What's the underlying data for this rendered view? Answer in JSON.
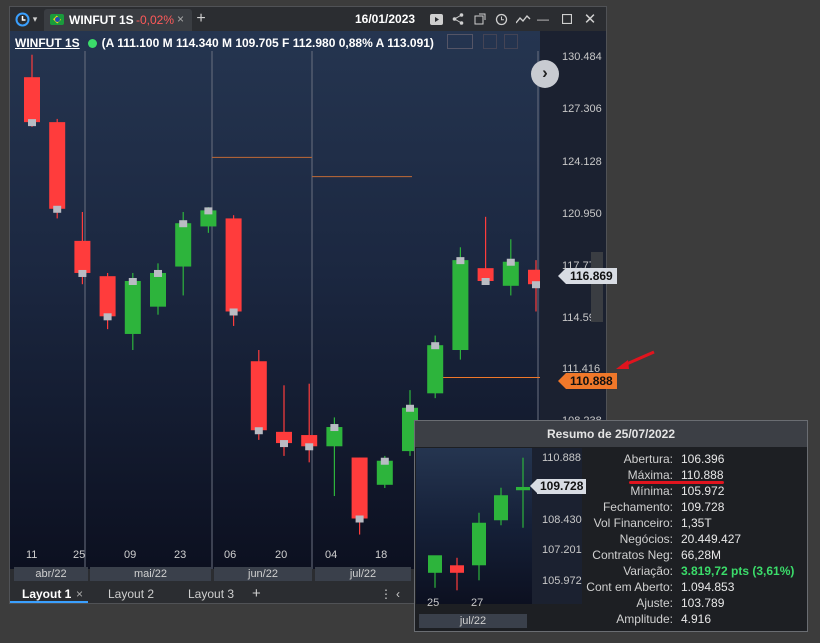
{
  "titlebar": {
    "tab_symbol": "WINFUT 1S",
    "tab_change": "-0,02%",
    "date": "16/01/2023"
  },
  "header": {
    "symbol": "WINFUT 1S",
    "quote": "(A 111.100 M 114.340 M 109.705 F 112.980 0,88% A 113.091)"
  },
  "price_scale": [
    "130.484",
    "127.306",
    "124.128",
    "120.950",
    "117.772",
    "114.594",
    "111.416",
    "108.238"
  ],
  "tags": {
    "last": "116.869",
    "high": "110.888"
  },
  "x_ticks": [
    "11",
    "25",
    "09",
    "23",
    "06",
    "20",
    "04",
    "18"
  ],
  "months": [
    "abr/22",
    "mai/22",
    "jun/22",
    "jul/22"
  ],
  "layouts": [
    "Layout 1",
    "Layout 2",
    "Layout 3"
  ],
  "colors": {
    "up": "#2db43c",
    "down": "#ff3c3c",
    "accent": "#f0782a"
  },
  "chart_data": {
    "type": "candlestick",
    "ylim": [
      105.5,
      131.5
    ],
    "candles": [
      {
        "o": 129.6,
        "h": 131.0,
        "l": 126.5,
        "c": 126.8
      },
      {
        "o": 126.8,
        "h": 127.0,
        "l": 120.8,
        "c": 121.4
      },
      {
        "o": 119.4,
        "h": 121.2,
        "l": 116.7,
        "c": 117.4
      },
      {
        "o": 117.2,
        "h": 117.4,
        "l": 113.9,
        "c": 114.7
      },
      {
        "o": 113.6,
        "h": 117.4,
        "l": 112.6,
        "c": 116.9
      },
      {
        "o": 115.3,
        "h": 118.0,
        "l": 114.8,
        "c": 117.4
      },
      {
        "o": 117.8,
        "h": 121.2,
        "l": 116.0,
        "c": 120.5
      },
      {
        "o": 120.3,
        "h": 121.5,
        "l": 119.9,
        "c": 121.3
      },
      {
        "o": 120.8,
        "h": 121.0,
        "l": 114.1,
        "c": 115.0
      },
      {
        "o": 111.9,
        "h": 112.6,
        "l": 107.0,
        "c": 107.6
      },
      {
        "o": 107.5,
        "h": 110.4,
        "l": 106.0,
        "c": 106.8
      },
      {
        "o": 107.3,
        "h": 110.5,
        "l": 105.6,
        "c": 106.6
      },
      {
        "o": 106.6,
        "h": 108.4,
        "l": 103.5,
        "c": 107.8
      },
      {
        "o": 105.9,
        "h": 105.9,
        "l": 101.1,
        "c": 102.1
      },
      {
        "o": 104.2,
        "h": 106.0,
        "l": 104.0,
        "c": 105.7
      },
      {
        "o": 106.3,
        "h": 110.1,
        "l": 106.0,
        "c": 109.0
      },
      {
        "o": 109.9,
        "h": 113.5,
        "l": 109.6,
        "c": 112.9
      },
      {
        "o": 112.6,
        "h": 119.0,
        "l": 112.0,
        "c": 118.2
      },
      {
        "o": 117.7,
        "h": 120.9,
        "l": 116.8,
        "c": 116.9
      },
      {
        "o": 116.6,
        "h": 119.5,
        "l": 116.0,
        "c": 118.1
      },
      {
        "o": 117.6,
        "h": 118.2,
        "l": 115.0,
        "c": 116.7
      }
    ],
    "reference_lines": [
      110.888
    ]
  },
  "summary": {
    "title": "Resumo de 25/07/2022",
    "mini_scale": [
      "110.888",
      "108.430",
      "107.201",
      "105.972"
    ],
    "mini_tag": "109.728",
    "mini_x": [
      "25",
      "27"
    ],
    "mini_month": "jul/22",
    "rows": [
      {
        "k": "Abertura:",
        "v": "106.396"
      },
      {
        "k": "Máxima:",
        "v": "110.888"
      },
      {
        "k": "Mínima:",
        "v": "105.972"
      },
      {
        "k": "Fechamento:",
        "v": "109.728"
      },
      {
        "k": "Vol Financeiro:",
        "v": "1,35T"
      },
      {
        "k": "Negócios:",
        "v": "20.449.427"
      },
      {
        "k": "Contratos Neg:",
        "v": "66,28M"
      },
      {
        "k": "Variação:",
        "v": "3.819,72 pts (3,61%)"
      },
      {
        "k": "Cont em Aberto:",
        "v": "1.094.853"
      },
      {
        "k": "Ajuste:",
        "v": "103.789"
      },
      {
        "k": "Amplitude:",
        "v": "4.916"
      }
    ]
  }
}
